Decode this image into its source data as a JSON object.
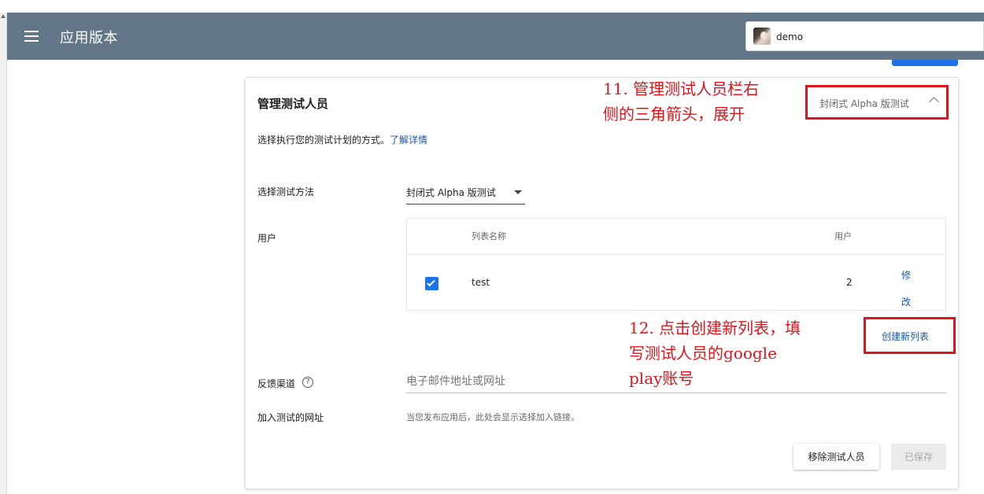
{
  "appbar": {
    "title": "应用版本",
    "menu_icon": "hamburger-menu-icon",
    "background": "#627687"
  },
  "user": {
    "name": "demo",
    "avatar_icon": "user-avatar-photo"
  },
  "card": {
    "title": "管理测试人员",
    "description": "选择执行您的测试计划的方式。",
    "learn_more": "了解详情",
    "collapse_label": "封闭式 Alpha 版测试",
    "collapse_icon": "chevron-up-icon"
  },
  "testing_method": {
    "label": "选择测试方法",
    "selected": "封闭式 Alpha 版测试"
  },
  "users": {
    "label": "用户",
    "columns": [
      "列表名称",
      "用户"
    ],
    "rows": [
      {
        "checked": true,
        "name": "test",
        "count": "2",
        "edit_label": "修改"
      }
    ],
    "create_list_label": "创建新列表"
  },
  "feedback": {
    "label": "反馈渠道",
    "placeholder": "电子邮件地址或网址",
    "value": ""
  },
  "optin": {
    "label": "加入测试的网址",
    "note": "当您发布应用后，此处会显示选择加入链接。"
  },
  "actions": {
    "remove_label": "移除测试人员",
    "saved_label": "已保存"
  },
  "annotations": [
    {
      "text": "11. 管理测试人员栏右\n侧的三角箭头，展开"
    },
    {
      "text": "12. 点击创建新列表，填\n写测试人员的google\nplay账号"
    }
  ],
  "colors": {
    "annotation": "#e0141b",
    "link": "#1a57a6",
    "checkbox": "#1a73e8"
  }
}
